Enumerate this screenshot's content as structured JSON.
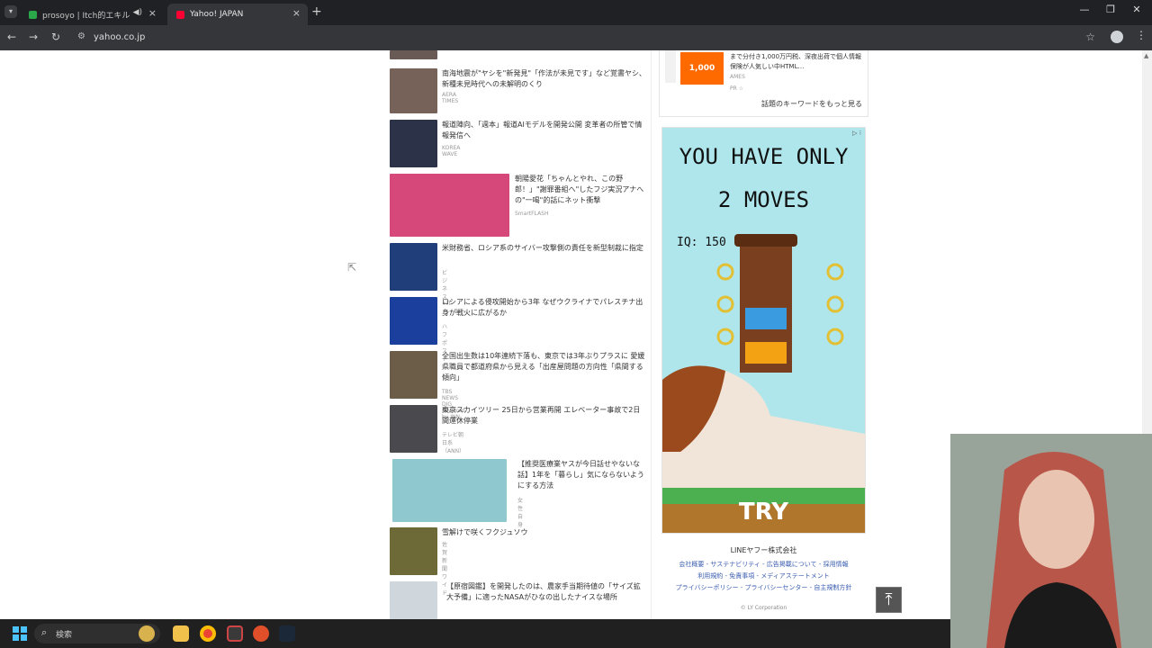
{
  "browser": {
    "tabs": [
      {
        "label": "prosoyo | Itch的エキル",
        "active": false
      },
      {
        "label": "Yahoo! JAPAN",
        "active": true
      }
    ],
    "url": "yahoo.co.jp"
  },
  "news": {
    "items": [
      {
        "headline": "南海地震が\"ヤシを\"新発見\"「作法が未見です」など覚書ヤシ、新種未見時代への未解明のくり",
        "source": "AERA TIMES"
      },
      {
        "headline": "報道陣向、「週本」報道AIモデルを開発公開 変革者の所管で情報発信へ",
        "source": "KOREA WAVE"
      },
      {
        "headline": "朝陽愛花「ちゃんとやれ、この野郎！」\"謝罪番組へ\"したフジ実況アナへの\"一喝\"的話にネット衝撃",
        "source": "SmartFLASH"
      },
      {
        "headline": "米財務省、ロシア系のサイバー攻撃側の責任を新型制裁に指定",
        "source": "ビジネス+IT"
      },
      {
        "headline": "ロシアによる侵攻開始から3年 なぜウクライナでパレスチナ出身が戦火に広がるか",
        "source": "ハフポスト"
      },
      {
        "headline": "全国出生数は10年連続下落も、東京では3年ぶりプラスに 愛媛県職員で都道府県から見える「出産屋問題の方向性「県間する傾向」",
        "source": "TBS NEWS DIG Powered by JNN"
      },
      {
        "headline": "東京スカイツリー 25日から営業再開 エレベーター事故で2日間運休停業",
        "source": "テレビ朝日系（ANN）"
      },
      {
        "headline": "【推奨医療業ヤスが今日話せやないな話】1年を「暮らし」気にならないようにする方法",
        "source": "女性自身"
      },
      {
        "headline": "雪解けで咲くフクジュソウ",
        "source": "佐賀新聞ワイド"
      },
      {
        "headline": "【原宿図鑑】を開発したのは、農家手当期待値の「サイズ拡大予備」に適ったNASAがひなの出したナイスな場所",
        "source": ""
      }
    ]
  },
  "sidebar": {
    "promo": {
      "badge_text": "1,000",
      "text": "まで分付き1,000万円税、深夜出荷で個人情報保険が人気しい中HTML…",
      "source": "AMES",
      "meta": "PR ☆",
      "more_link": "話題のキーワードをもっと見る"
    },
    "ad": {
      "headline_1": "YOU HAVE ONLY",
      "headline_2": "2 MOVES",
      "iq": "IQ: 150",
      "cta": "TRY",
      "info": "▷ ⁝"
    },
    "footer": {
      "company": "LINEヤフー株式会社",
      "links_1": "会社概要 - サステナビリティ - 広告掲載について - 採用情報",
      "links_2": "利用規約 - 免責事項 - メディアステートメント",
      "links_3": "プライバシーポリシー - プライバシーセンター - 自主規制方針",
      "copyright": "© LY Corporation"
    }
  },
  "taskbar": {
    "search_label": "検索"
  },
  "colors": {
    "chrome_dark": "#202124",
    "chrome_mid": "#35363a",
    "link_blue": "#3a5db0",
    "ad_bg": "#aee6ec"
  },
  "icons": [
    "tab-menu-icon",
    "speaker-icon",
    "close-icon",
    "new-tab-icon",
    "back-icon",
    "forward-icon",
    "reload-icon",
    "tune-icon",
    "star-icon",
    "profile-icon",
    "kebab-icon",
    "cursor-icon",
    "scroll-top-icon",
    "windows-icon",
    "search-icon"
  ]
}
